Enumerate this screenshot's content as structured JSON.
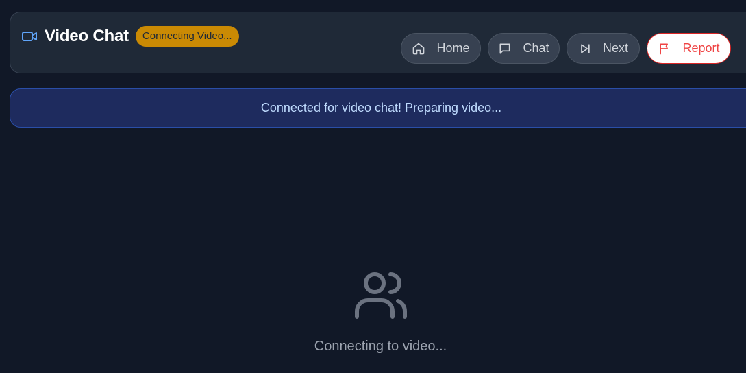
{
  "header": {
    "title": "Video Chat",
    "status_badge": "Connecting Video...",
    "icons": {
      "brand": "video-camera-icon"
    }
  },
  "nav": {
    "home": {
      "label": "Home",
      "icon": "home-icon"
    },
    "chat": {
      "label": "Chat",
      "icon": "chat-bubble-icon"
    },
    "next": {
      "label": "Next",
      "icon": "skip-forward-icon"
    },
    "report": {
      "label": "Report",
      "icon": "flag-icon"
    }
  },
  "banner": {
    "message": "Connected for video chat! Preparing video..."
  },
  "video_area": {
    "icon": "users-icon",
    "status": "Connecting to video..."
  },
  "colors": {
    "background": "#111827",
    "accent_blue": "#60a5fa",
    "badge_amber": "#ca8a04",
    "report_red": "#ef4444"
  }
}
